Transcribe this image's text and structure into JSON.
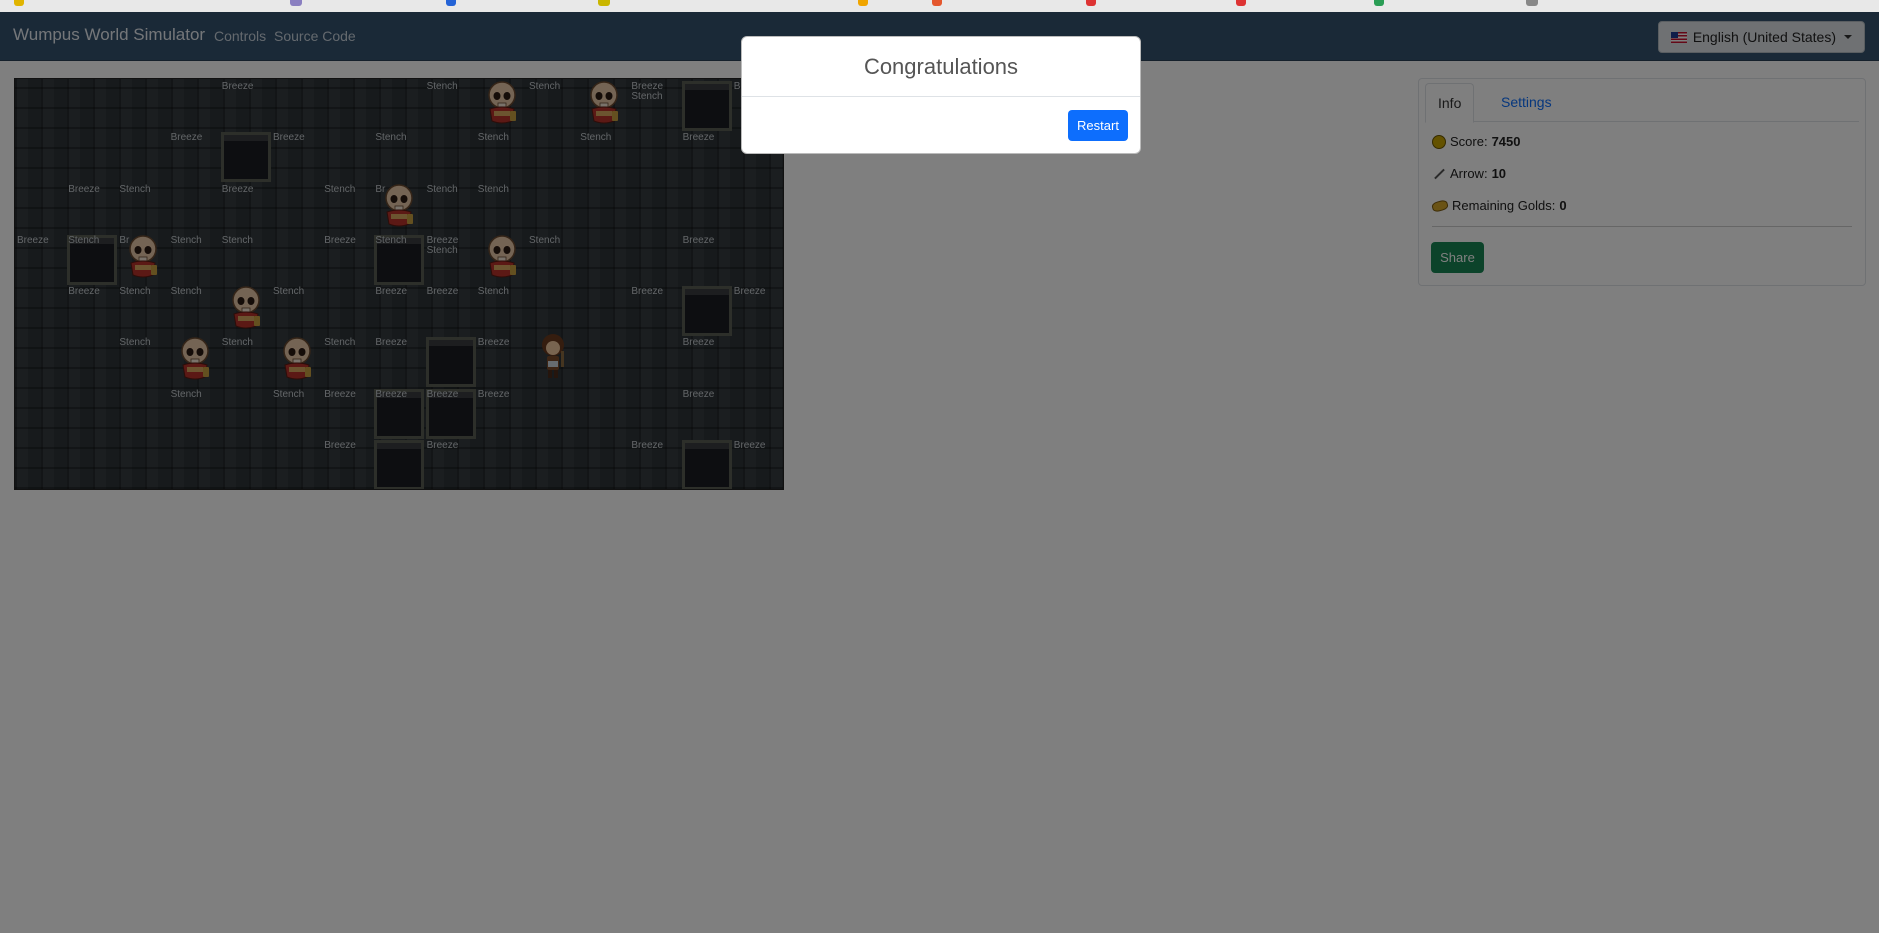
{
  "navbar": {
    "brand": "Wumpus World Simulator",
    "links": [
      "Controls",
      "Source Code"
    ],
    "language": "English (United States)"
  },
  "board": {
    "labels": [
      {
        "t": "Breeze",
        "c": 4,
        "r": 0
      },
      {
        "t": "Stench",
        "c": 8,
        "r": 0
      },
      {
        "t": "Stench",
        "c": 10,
        "r": 0
      },
      {
        "t": "Breeze",
        "c": 12,
        "r": 0
      },
      {
        "t": "Stench",
        "c": 12,
        "r": 0,
        "second": true
      },
      {
        "t": "Breeze",
        "c": 14,
        "r": 0
      },
      {
        "t": "Breeze",
        "c": 3,
        "r": 1
      },
      {
        "t": "Breeze",
        "c": 5,
        "r": 1
      },
      {
        "t": "Stench",
        "c": 7,
        "r": 1
      },
      {
        "t": "Stench",
        "c": 9,
        "r": 1
      },
      {
        "t": "Stench",
        "c": 11,
        "r": 1
      },
      {
        "t": "Breeze",
        "c": 13,
        "r": 1
      },
      {
        "t": "Breeze",
        "c": 1,
        "r": 2
      },
      {
        "t": "Stench",
        "c": 2,
        "r": 2
      },
      {
        "t": "Breeze",
        "c": 4,
        "r": 2
      },
      {
        "t": "Stench",
        "c": 6,
        "r": 2
      },
      {
        "t": "Br",
        "c": 7,
        "r": 2
      },
      {
        "t": "Stench",
        "c": 8,
        "r": 2
      },
      {
        "t": "Stench",
        "c": 9,
        "r": 2
      },
      {
        "t": "Breeze",
        "c": 0,
        "r": 3
      },
      {
        "t": "Stench",
        "c": 1,
        "r": 3
      },
      {
        "t": "Br",
        "c": 2,
        "r": 3
      },
      {
        "t": "Stench",
        "c": 3,
        "r": 3
      },
      {
        "t": "Stench",
        "c": 4,
        "r": 3
      },
      {
        "t": "Breeze",
        "c": 6,
        "r": 3
      },
      {
        "t": "Stench",
        "c": 7,
        "r": 3
      },
      {
        "t": "Breeze",
        "c": 8,
        "r": 3
      },
      {
        "t": "Stench",
        "c": 8,
        "r": 3,
        "second": true
      },
      {
        "t": "Stench",
        "c": 10,
        "r": 3
      },
      {
        "t": "Breeze",
        "c": 13,
        "r": 3
      },
      {
        "t": "Breeze",
        "c": 1,
        "r": 4
      },
      {
        "t": "Stench",
        "c": 2,
        "r": 4
      },
      {
        "t": "Stench",
        "c": 3,
        "r": 4
      },
      {
        "t": "Stench",
        "c": 5,
        "r": 4
      },
      {
        "t": "Breeze",
        "c": 7,
        "r": 4
      },
      {
        "t": "Breeze",
        "c": 8,
        "r": 4
      },
      {
        "t": "Stench",
        "c": 9,
        "r": 4
      },
      {
        "t": "Breeze",
        "c": 12,
        "r": 4
      },
      {
        "t": "Breeze",
        "c": 14,
        "r": 4
      },
      {
        "t": "Stench",
        "c": 2,
        "r": 5
      },
      {
        "t": "Stench",
        "c": 4,
        "r": 5
      },
      {
        "t": "Stench",
        "c": 6,
        "r": 5
      },
      {
        "t": "Breeze",
        "c": 7,
        "r": 5
      },
      {
        "t": "Breeze",
        "c": 9,
        "r": 5
      },
      {
        "t": "Breeze",
        "c": 13,
        "r": 5
      },
      {
        "t": "Stench",
        "c": 3,
        "r": 6
      },
      {
        "t": "Stench",
        "c": 5,
        "r": 6
      },
      {
        "t": "Breeze",
        "c": 6,
        "r": 6
      },
      {
        "t": "Breeze",
        "c": 7,
        "r": 6
      },
      {
        "t": "Breeze",
        "c": 8,
        "r": 6
      },
      {
        "t": "Breeze",
        "c": 9,
        "r": 6
      },
      {
        "t": "Breeze",
        "c": 13,
        "r": 6
      },
      {
        "t": "Breeze",
        "c": 6,
        "r": 7
      },
      {
        "t": "Breeze",
        "c": 8,
        "r": 7
      },
      {
        "t": "Breeze",
        "c": 12,
        "r": 7
      },
      {
        "t": "Breeze",
        "c": 14,
        "r": 7
      }
    ],
    "pits": [
      {
        "c": 13,
        "r": 0
      },
      {
        "c": 4,
        "r": 1
      },
      {
        "c": 1,
        "r": 3
      },
      {
        "c": 7,
        "r": 3
      },
      {
        "c": 13,
        "r": 4
      },
      {
        "c": 8,
        "r": 5
      },
      {
        "c": 7,
        "r": 6
      },
      {
        "c": 8,
        "r": 6
      },
      {
        "c": 7,
        "r": 7
      },
      {
        "c": 13,
        "r": 7
      }
    ],
    "wumpuses": [
      {
        "c": 9,
        "r": 0
      },
      {
        "c": 11,
        "r": 0
      },
      {
        "c": 7,
        "r": 2
      },
      {
        "c": 2,
        "r": 3
      },
      {
        "c": 9,
        "r": 3
      },
      {
        "c": 4,
        "r": 4
      },
      {
        "c": 3,
        "r": 5
      },
      {
        "c": 5,
        "r": 5
      }
    ],
    "hero": {
      "c": 10,
      "r": 5
    }
  },
  "info": {
    "tabs": [
      "Info",
      "Settings"
    ],
    "score_label": "Score:",
    "score": "7450",
    "arrow_label": "Arrow:",
    "arrow": "10",
    "golds_label": "Remaining Golds:",
    "golds": "0",
    "share": "Share"
  },
  "modal": {
    "title": "Congratulations",
    "restart": "Restart"
  }
}
